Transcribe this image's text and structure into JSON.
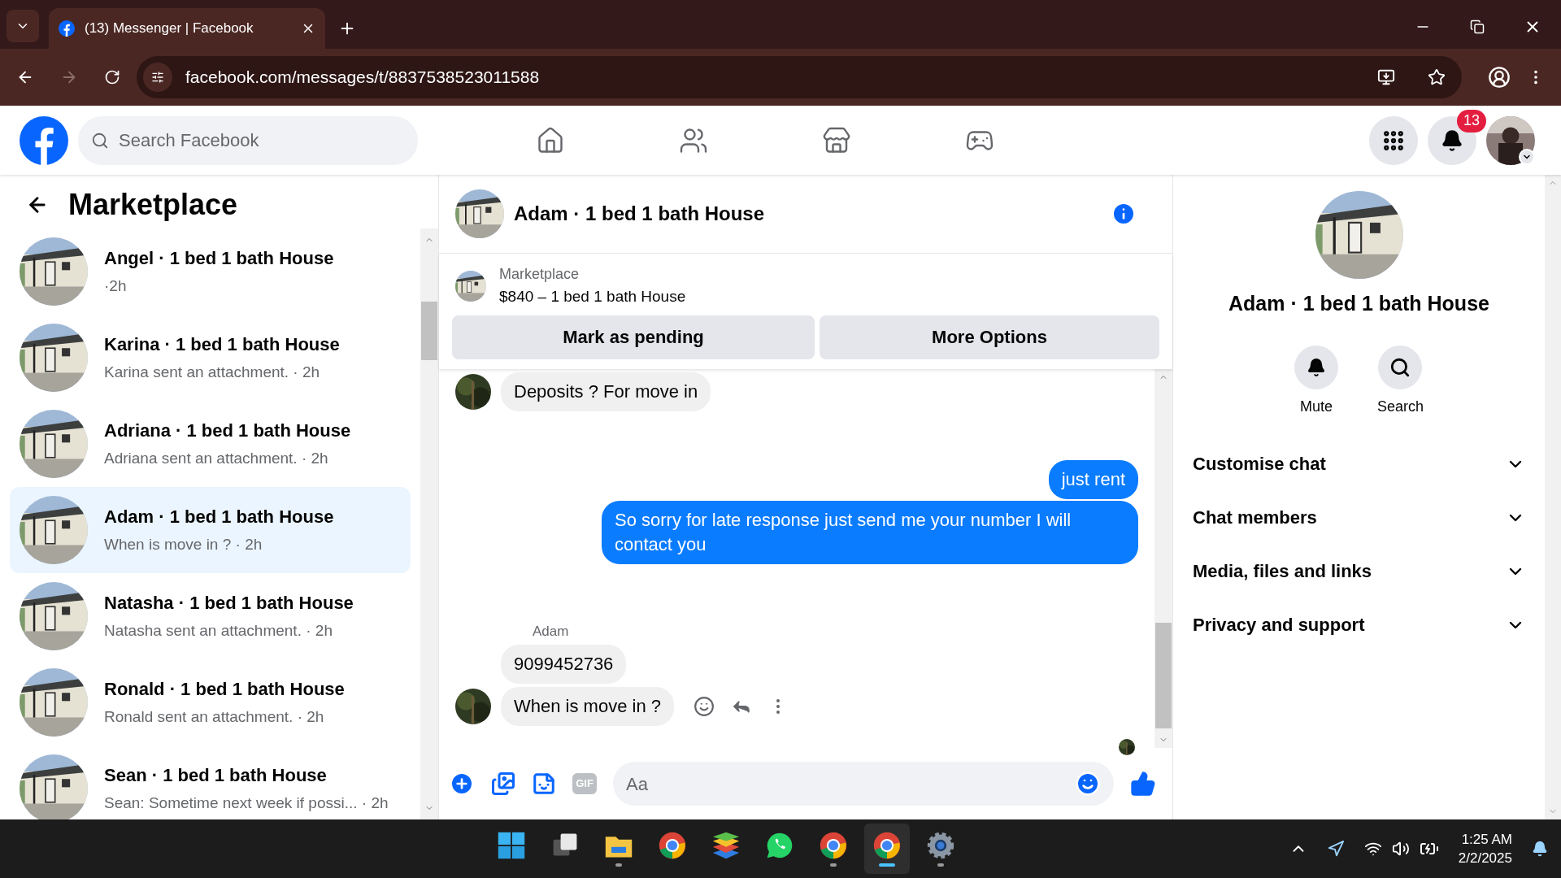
{
  "browser": {
    "tab_title": "(13) Messenger | Facebook",
    "url": "facebook.com/messages/t/8837538523011588"
  },
  "facebook": {
    "search_placeholder": "Search Facebook",
    "notification_count": "13"
  },
  "sidebar": {
    "title": "Marketplace",
    "chats": [
      {
        "title": "Angel · 1 bed 1 bath House",
        "time": "·2h",
        "selected": false
      },
      {
        "title": "Karina · 1 bed 1 bath House",
        "preview": "Karina sent an attachment.",
        "time": "· 2h",
        "selected": false
      },
      {
        "title": "Adriana · 1 bed 1 bath House",
        "preview": "Adriana sent an attachment.",
        "time": "· 2h",
        "selected": false
      },
      {
        "title": "Adam · 1 bed 1 bath House",
        "preview": "When is move in ?",
        "time": "· 2h",
        "selected": true
      },
      {
        "title": "Natasha · 1 bed 1 bath House",
        "preview": "Natasha sent an attachment.",
        "time": "· 2h",
        "selected": false
      },
      {
        "title": "Ronald · 1 bed 1 bath House",
        "preview": "Ronald sent an attachment.",
        "time": "· 2h",
        "selected": false
      },
      {
        "title": "Sean · 1 bed 1 bath House",
        "preview": "Sean: Sometime next week if possi...",
        "time": "· 2h",
        "selected": false
      }
    ]
  },
  "chat": {
    "title": "Adam · 1 bed 1 bath House",
    "listing": {
      "label": "Marketplace",
      "text": "$840 – 1 bed 1 bath House"
    },
    "actions": [
      "Mark as pending",
      "More Options"
    ],
    "messages": [
      {
        "kind": "incoming",
        "text": "Deposits ? For move in",
        "avatar": true,
        "hovered": false
      },
      {
        "kind": "outgoing",
        "text": "just rent"
      },
      {
        "kind": "outgoing",
        "text": "So sorry for late response just send me your number I will contact you"
      },
      {
        "kind": "incoming",
        "sender": "Adam",
        "text": "9099452736",
        "avatar": false,
        "hovered": false
      },
      {
        "kind": "incoming",
        "text": "When is move in ?",
        "avatar": true,
        "hovered": true
      }
    ],
    "composer": {
      "gif_label": "GIF",
      "placeholder": "Aa"
    }
  },
  "details": {
    "title": "Adam · 1 bed 1 bath House",
    "buttons": [
      {
        "kind": "mute",
        "label": "Mute"
      },
      {
        "kind": "search",
        "label": "Search"
      }
    ],
    "sections": [
      {
        "label": "Customise chat",
        "expanded": false
      },
      {
        "label": "Chat members",
        "expanded": false
      },
      {
        "label": "Media, files and links",
        "expanded": false
      },
      {
        "label": "Privacy and support",
        "expanded": false
      }
    ]
  },
  "taskbar": {
    "apps": [
      {
        "kind": "start",
        "running": false,
        "active": false
      },
      {
        "kind": "taskview",
        "running": false,
        "active": false
      },
      {
        "kind": "explorer",
        "running": true,
        "active": false
      },
      {
        "kind": "chrome",
        "running": false,
        "active": false
      },
      {
        "kind": "stack",
        "running": false,
        "active": false
      },
      {
        "kind": "whatsapp",
        "running": false,
        "active": false
      },
      {
        "kind": "chrome",
        "running": true,
        "active": false
      },
      {
        "kind": "chrome",
        "running": true,
        "active": true
      },
      {
        "kind": "settings",
        "running": true,
        "active": false
      }
    ],
    "time": "1:25 AM",
    "date": "2/2/2025"
  }
}
